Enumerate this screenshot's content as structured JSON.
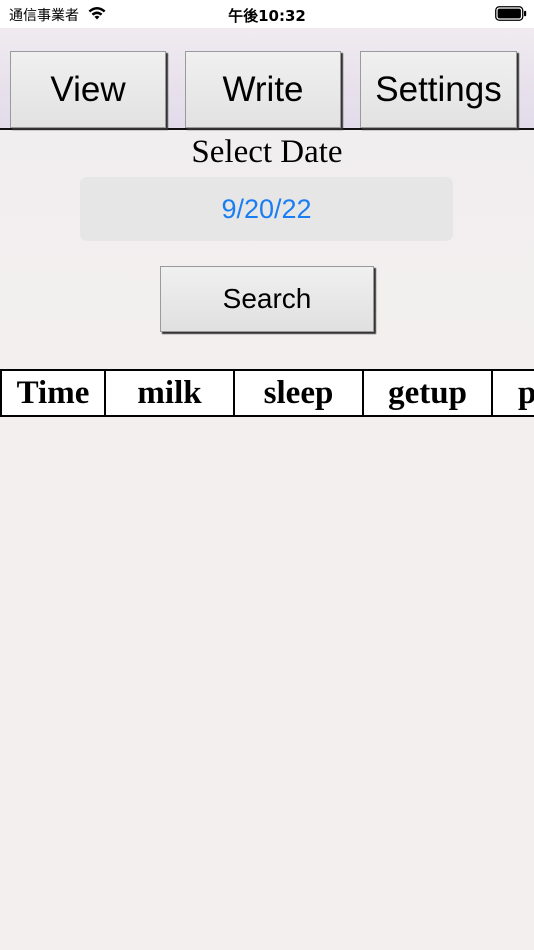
{
  "status_bar": {
    "carrier": "通信事業者",
    "time": "午後10:32"
  },
  "nav": {
    "view_label": "View",
    "write_label": "Write",
    "settings_label": "Settings"
  },
  "date_select": {
    "label": "Select Date",
    "value": "9/20/22",
    "value_color": "#1a7ef2"
  },
  "search": {
    "label": "Search"
  },
  "table": {
    "headers": [
      "Time",
      "milk",
      "sleep",
      "getup",
      "p"
    ]
  }
}
